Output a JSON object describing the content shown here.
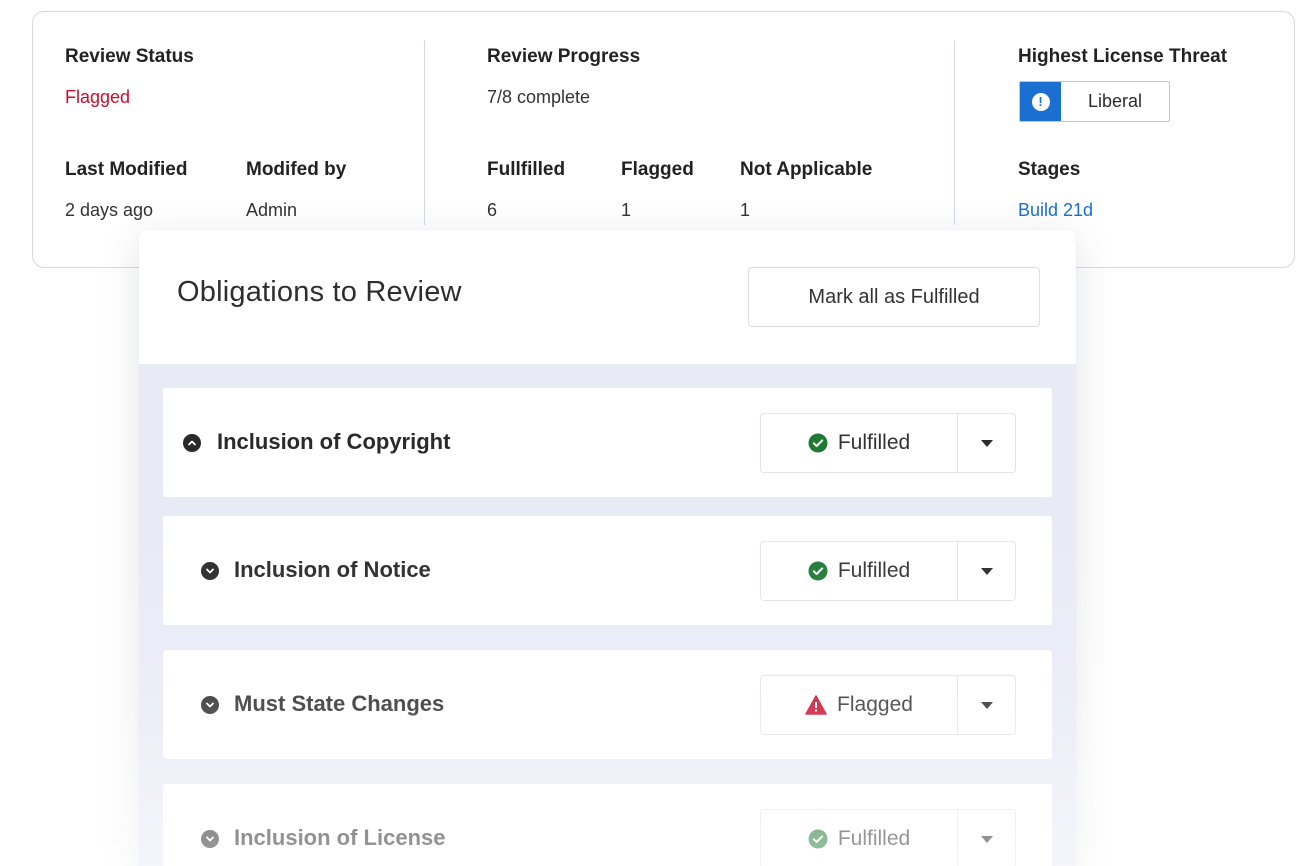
{
  "summary": {
    "review_status": {
      "label": "Review Status",
      "value": "Flagged"
    },
    "last_modified": {
      "label": "Last Modified",
      "value": "2 days ago"
    },
    "modified_by": {
      "label": "Modifed by",
      "value": "Admin"
    },
    "review_progress": {
      "label": "Review Progress",
      "value": "7/8 complete"
    },
    "fulfilled": {
      "label": "Fullfilled",
      "value": "6"
    },
    "flagged": {
      "label": "Flagged",
      "value": "1"
    },
    "not_applicable": {
      "label": "Not Applicable",
      "value": "1"
    },
    "highest_threat": {
      "label": "Highest License Threat",
      "value": "Liberal",
      "icon": "alert-icon"
    },
    "stages": {
      "label": "Stages",
      "value": "Build 21d"
    }
  },
  "panel": {
    "title": "Obligations to Review",
    "mark_all_label": "Mark all as Fulfilled",
    "obligations": [
      {
        "name": "Inclusion of Copyright",
        "status": "Fulfilled",
        "expanded": true
      },
      {
        "name": "Inclusion of Notice",
        "status": "Fulfilled",
        "expanded": false
      },
      {
        "name": "Must State Changes",
        "status": "Flagged",
        "expanded": false
      },
      {
        "name": "Inclusion of License",
        "status": "Fulfilled",
        "expanded": false
      }
    ]
  },
  "colors": {
    "flagged_red": "#c8102e",
    "fulfilled_green": "#1f7a33",
    "link_blue": "#1a6fd1",
    "panel_body": "#e8eaf6"
  }
}
